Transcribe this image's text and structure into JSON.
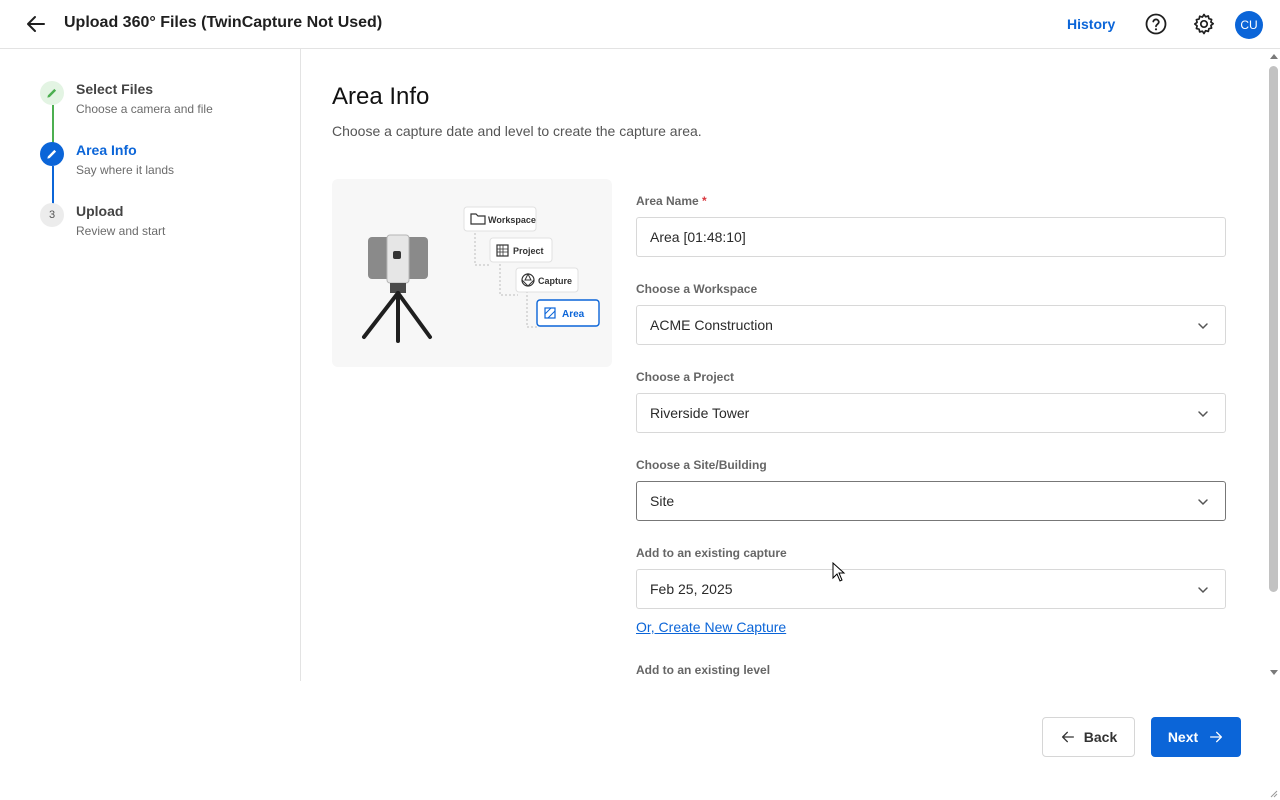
{
  "header": {
    "title": "Upload 360° Files (TwinCapture Not Used)",
    "history_label": "History",
    "avatar_initials": "CU",
    "accent_color": "#0b65d8"
  },
  "stepper": {
    "steps": [
      {
        "number": "",
        "title": "Select Files",
        "subtitle": "Choose a camera and file",
        "state": "complete",
        "icon": "pencil-icon"
      },
      {
        "number": "",
        "title": "Area Info",
        "subtitle": "Say where it lands",
        "state": "active",
        "icon": "pencil-icon"
      },
      {
        "number": "3",
        "title": "Upload",
        "subtitle": "Review and start",
        "state": "pending"
      }
    ]
  },
  "main": {
    "title": "Area Info",
    "subtitle": "Choose a capture date and level to create the capture area.",
    "illustration": {
      "nodes": [
        "Workspace",
        "Project",
        "Capture",
        "Area"
      ]
    },
    "fields": {
      "area_name": {
        "label": "Area Name",
        "required_mark": "*",
        "value": "Area [01:48:10]"
      },
      "workspace": {
        "label": "Choose a Workspace",
        "value": "ACME Construction"
      },
      "project": {
        "label": "Choose a Project",
        "value": "Riverside Tower"
      },
      "site": {
        "label": "Choose a Site/Building",
        "value": "Site"
      },
      "capture": {
        "label": "Add to an existing capture",
        "value": "Feb 25, 2025"
      },
      "level": {
        "label": "Add to an existing level"
      }
    },
    "create_capture_link": "Or, Create New Capture"
  },
  "footer": {
    "back_label": "Back",
    "next_label": "Next"
  }
}
